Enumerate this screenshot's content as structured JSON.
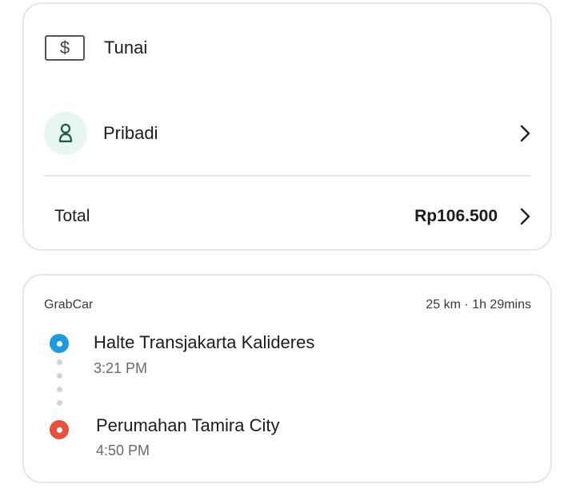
{
  "payment": {
    "method_label": "Tunai",
    "method_icon": "cash-dollar-icon",
    "profile_label": "Pribadi",
    "profile_icon": "person-icon",
    "total_label": "Total",
    "total_amount": "Rp106.500"
  },
  "trip": {
    "service": "GrabCar",
    "summary": "25 km · 1h 29mins",
    "origin": {
      "name": "Halte Transjakarta Kalideres",
      "time": "3:21 PM"
    },
    "destination": {
      "name": "Perumahan Tamira City",
      "time": "4:50 PM"
    }
  },
  "colors": {
    "origin_pin": "#1e9be0",
    "destination_pin": "#e8503a",
    "profile_icon_bg": "#e8f6f1",
    "profile_icon_stroke": "#1d5a45"
  }
}
